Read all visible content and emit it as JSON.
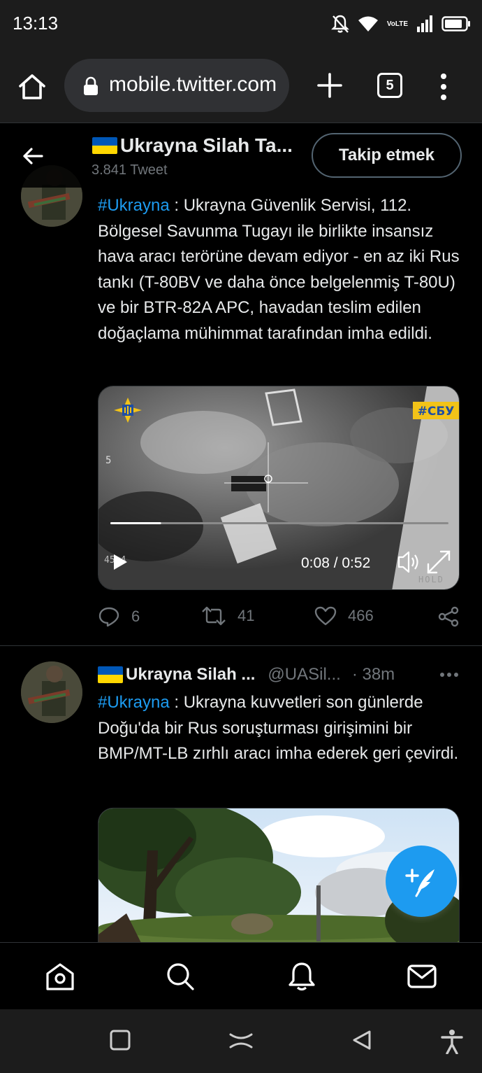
{
  "status_bar": {
    "time": "13:13",
    "network_label": "VoLTE"
  },
  "browser": {
    "url": "mobile.twitter.com",
    "tab_count": "5"
  },
  "profile_header": {
    "name": "Ukrayna Silah Ta...",
    "tweet_count": "3.841 Tweet",
    "follow_label": "Takip etmek"
  },
  "tweet1": {
    "hashtag": "#Ukrayna",
    "text": " : Ukrayna Güvenlik Servisi, 112. Bölgesel Savunma Tugayı ile birlikte insansız hava aracı terörüne devam ediyor - en az iki Rus tankı (T-80BV ve daha önce belgelenmiş T-80U) ve bir BTR-82A APC, havadan teslim edilen doğaçlama mühimmat tarafından imha edildi.",
    "video": {
      "tag": "#СБУ",
      "time": "0:08 / 0:52",
      "progress": 0.15,
      "overlay_digit": "5",
      "overlay_bottom_left": "45 4",
      "overlay_bottom_right": "HOLD"
    },
    "replies": "6",
    "retweets": "41",
    "likes": "466"
  },
  "tweet2": {
    "name": "Ukrayna Silah ...",
    "handle": "@UASil...",
    "time": "· 38m",
    "hashtag": "#Ukrayna",
    "text": " : Ukrayna kuvvetleri son günlerde Doğu'da bir Rus soruşturması girişimini bir BMP/MT-LB zırhlı aracı imha ederek geri çevirdi."
  },
  "colors": {
    "accent": "#1d9bf0",
    "background": "#000000",
    "secondary_text": "#71767b",
    "flag_blue": "#0057b7",
    "flag_yellow": "#ffd700"
  }
}
